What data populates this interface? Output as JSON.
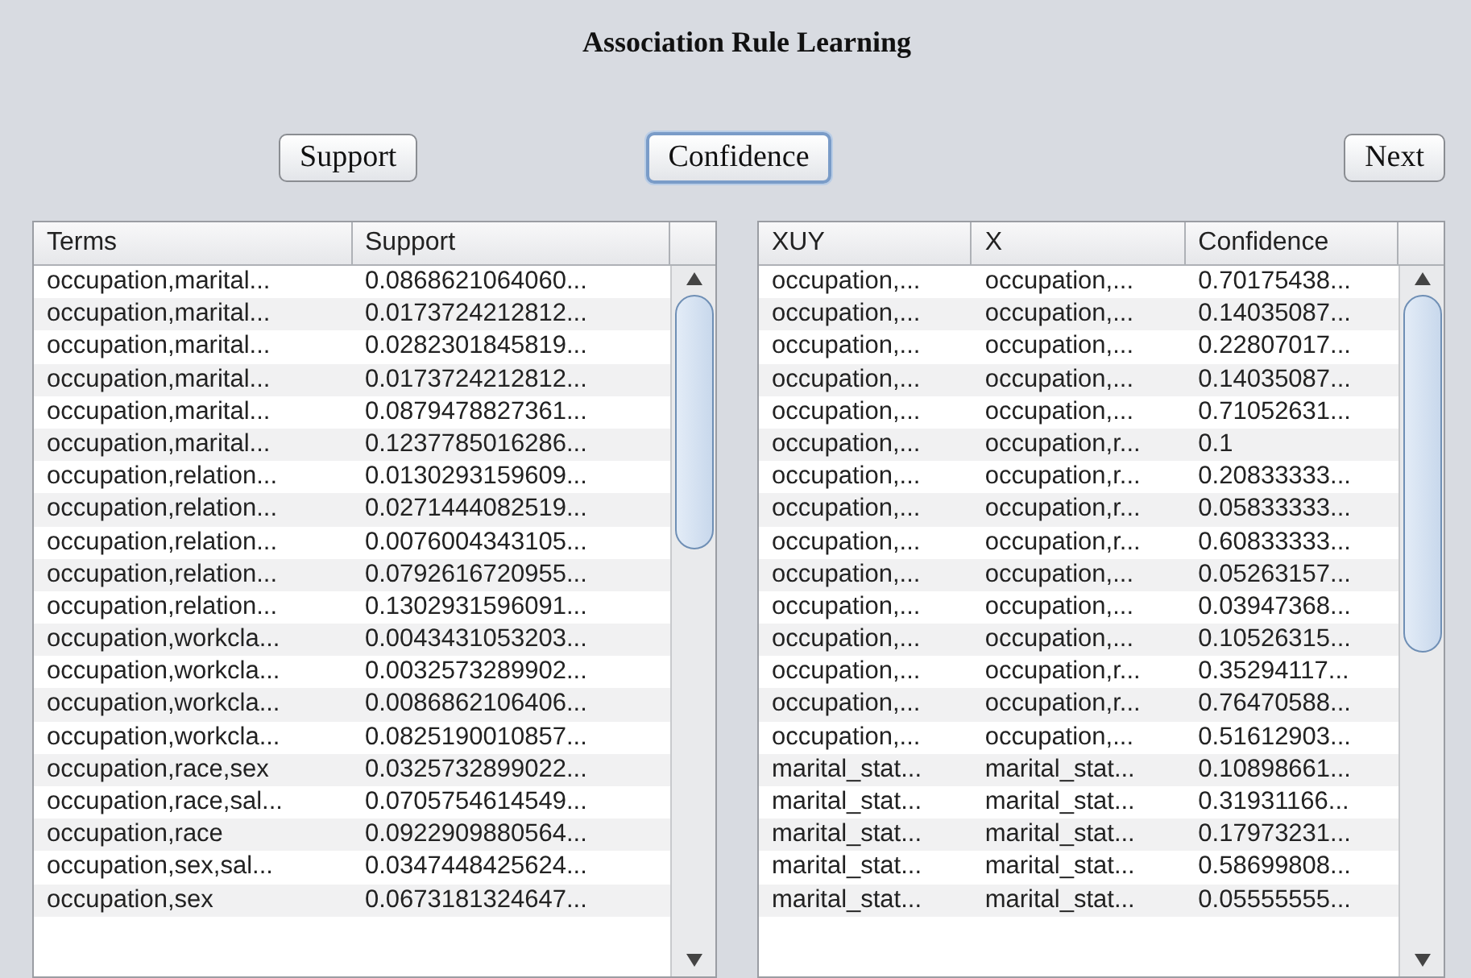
{
  "title": "Association Rule Learning",
  "buttons": [
    {
      "label": "Support",
      "focused": false
    },
    {
      "label": "Confidence",
      "focused": true
    },
    {
      "label": "Next",
      "focused": false
    }
  ],
  "support_table": {
    "columns": [
      "Terms",
      "Support"
    ],
    "rows": [
      [
        "occupation,marital...",
        "0.0868621064060..."
      ],
      [
        "occupation,marital...",
        "0.0173724212812..."
      ],
      [
        "occupation,marital...",
        "0.0282301845819..."
      ],
      [
        "occupation,marital...",
        "0.0173724212812..."
      ],
      [
        "occupation,marital...",
        "0.0879478827361..."
      ],
      [
        "occupation,marital...",
        "0.1237785016286..."
      ],
      [
        "occupation,relation...",
        "0.0130293159609..."
      ],
      [
        "occupation,relation...",
        "0.0271444082519..."
      ],
      [
        "occupation,relation...",
        "0.0076004343105..."
      ],
      [
        "occupation,relation...",
        "0.0792616720955..."
      ],
      [
        "occupation,relation...",
        "0.1302931596091..."
      ],
      [
        "occupation,workcla...",
        "0.0043431053203..."
      ],
      [
        "occupation,workcla...",
        "0.0032573289902..."
      ],
      [
        "occupation,workcla...",
        "0.0086862106406..."
      ],
      [
        "occupation,workcla...",
        "0.0825190010857..."
      ],
      [
        "occupation,race,sex",
        "0.0325732899022..."
      ],
      [
        "occupation,race,sal...",
        "0.0705754614549..."
      ],
      [
        "occupation,race",
        "0.0922909880564..."
      ],
      [
        "occupation,sex,sal...",
        "0.0347448425624..."
      ],
      [
        "occupation,sex",
        "0.0673181324647..."
      ]
    ]
  },
  "confidence_table": {
    "columns": [
      "XUY",
      "X",
      "Confidence"
    ],
    "rows": [
      [
        "occupation,...",
        "occupation,...",
        "0.70175438..."
      ],
      [
        "occupation,...",
        "occupation,...",
        "0.14035087..."
      ],
      [
        "occupation,...",
        "occupation,...",
        "0.22807017..."
      ],
      [
        "occupation,...",
        "occupation,...",
        "0.14035087..."
      ],
      [
        "occupation,...",
        "occupation,...",
        "0.71052631..."
      ],
      [
        "occupation,...",
        "occupation,r...",
        "0.1"
      ],
      [
        "occupation,...",
        "occupation,r...",
        "0.20833333..."
      ],
      [
        "occupation,...",
        "occupation,r...",
        "0.05833333..."
      ],
      [
        "occupation,...",
        "occupation,r...",
        "0.60833333..."
      ],
      [
        "occupation,...",
        "occupation,...",
        "0.05263157..."
      ],
      [
        "occupation,...",
        "occupation,...",
        "0.03947368..."
      ],
      [
        "occupation,...",
        "occupation,...",
        "0.10526315..."
      ],
      [
        "occupation,...",
        "occupation,r...",
        "0.35294117..."
      ],
      [
        "occupation,...",
        "occupation,r...",
        "0.76470588..."
      ],
      [
        "occupation,...",
        "occupation,...",
        "0.51612903..."
      ],
      [
        "marital_stat...",
        "marital_stat...",
        "0.10898661..."
      ],
      [
        "marital_stat...",
        "marital_stat...",
        "0.31931166..."
      ],
      [
        "marital_stat...",
        "marital_stat...",
        "0.17973231..."
      ],
      [
        "marital_stat...",
        "marital_stat...",
        "0.58699808..."
      ],
      [
        "marital_stat...",
        "marital_stat...",
        "0.05555555..."
      ]
    ]
  }
}
